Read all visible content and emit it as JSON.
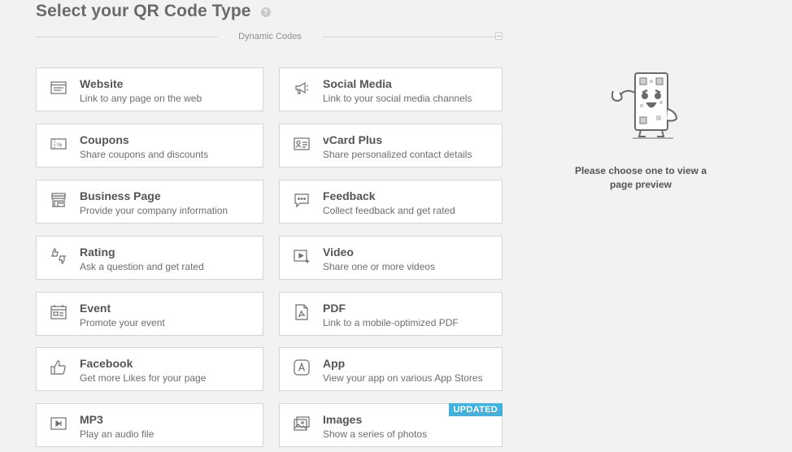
{
  "header": {
    "title": "Select your QR Code Type",
    "help_icon": "question-circle-icon"
  },
  "section": {
    "label": "Dynamic Codes"
  },
  "cards": [
    {
      "title": "Website",
      "subtitle": "Link to any page on the web",
      "icon": "browser-window-icon"
    },
    {
      "title": "Social Media",
      "subtitle": "Link to your social media channels",
      "icon": "megaphone-icon"
    },
    {
      "title": "Coupons",
      "subtitle": "Share coupons and discounts",
      "icon": "coupon-icon"
    },
    {
      "title": "vCard Plus",
      "subtitle": "Share personalized contact details",
      "icon": "contact-card-icon"
    },
    {
      "title": "Business Page",
      "subtitle": "Provide your company information",
      "icon": "storefront-icon"
    },
    {
      "title": "Feedback",
      "subtitle": "Collect feedback and get rated",
      "icon": "chat-bubble-icon"
    },
    {
      "title": "Rating",
      "subtitle": "Ask a question and get rated",
      "icon": "thumbs-up-down-icon"
    },
    {
      "title": "Video",
      "subtitle": "Share one or more videos",
      "icon": "video-play-icon"
    },
    {
      "title": "Event",
      "subtitle": "Promote your event",
      "icon": "event-calendar-icon"
    },
    {
      "title": "PDF",
      "subtitle": "Link to a mobile-optimized PDF",
      "icon": "pdf-document-icon"
    },
    {
      "title": "Facebook",
      "subtitle": "Get more Likes for your page",
      "icon": "like-thumb-icon"
    },
    {
      "title": "App",
      "subtitle": "View your app on various App Stores",
      "icon": "app-store-icon"
    },
    {
      "title": "MP3",
      "subtitle": "Play an audio file",
      "icon": "audio-play-icon"
    },
    {
      "title": "Images",
      "subtitle": "Show a series of photos",
      "icon": "image-gallery-icon",
      "badge": "UPDATED"
    }
  ],
  "preview": {
    "mascot_icon": "qr-code-mascot-icon",
    "text": "Please choose one to view a page preview"
  },
  "colors": {
    "background": "#f2f2f2",
    "card_border": "#d5d5d5",
    "badge": "#3fb2e0",
    "text": "#555555"
  }
}
